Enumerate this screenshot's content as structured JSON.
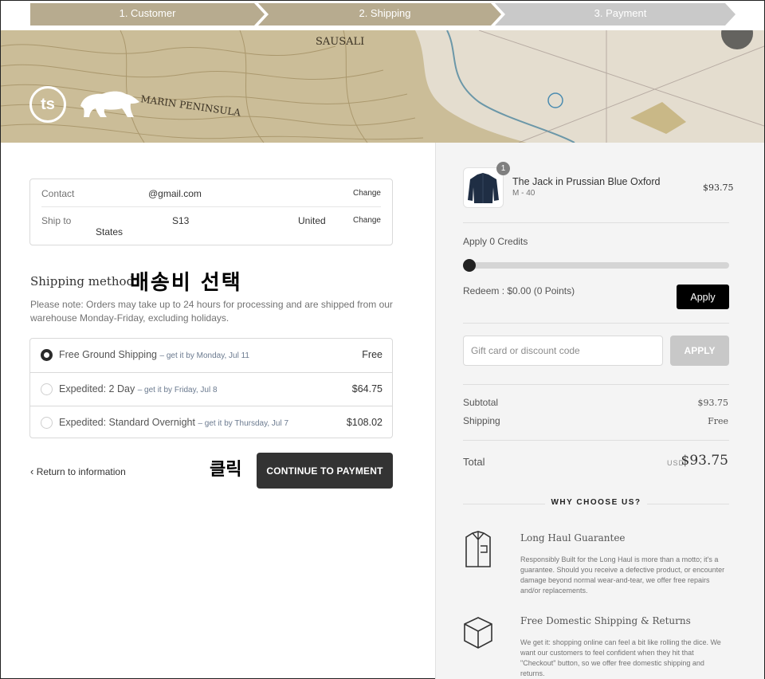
{
  "steps": [
    {
      "label": "1. Customer",
      "state": "done"
    },
    {
      "label": "2. Shipping",
      "state": "active"
    },
    {
      "label": "3. Payment",
      "state": "todo"
    }
  ],
  "colors": {
    "step_done": "#b7ab8f",
    "step_todo": "#c9c9c9",
    "button_dark": "#333333",
    "apply_black": "#000000"
  },
  "banner": {
    "map_texts": [
      "SAUSALI",
      "MARIN PENINSULA"
    ],
    "logo_text": "ts"
  },
  "contact": {
    "contact_label": "Contact",
    "contact_value": "@gmail.com",
    "ship_label": "Ship to",
    "ship_value_a": "S13",
    "ship_value_b": "United",
    "ship_value_c": "States",
    "change_label": "Change"
  },
  "shipping": {
    "title": "Shipping method",
    "annotation": "배송비 선택",
    "note": "Please note: Orders may take up to 24 hours for processing and are shipped from our warehouse Monday-Friday, excluding holidays.",
    "methods": [
      {
        "name": "Free Ground Shipping",
        "eta": "get it by Monday, Jul 11",
        "price": "Free",
        "selected": true
      },
      {
        "name": "Expedited: 2 Day",
        "eta": "get it by Friday, Jul 8",
        "price": "$64.75",
        "selected": false
      },
      {
        "name": "Expedited: Standard Overnight",
        "eta": "get it by Thursday, Jul 7",
        "price": "$108.02",
        "selected": false
      }
    ],
    "separator": "–"
  },
  "footer_actions": {
    "return_label": "Return to information",
    "click_annotation": "클릭",
    "continue_label": "CONTINUE TO PAYMENT"
  },
  "sidebar": {
    "product": {
      "name": "The Jack in Prussian Blue Oxford",
      "variant": "M - 40",
      "price": "$93.75",
      "quantity": "1"
    },
    "credits_label": "Apply 0 Credits",
    "credits_value": 0,
    "redeem_label": "Redeem : $0.00 (0 Points)",
    "apply_label": "Apply",
    "gift_placeholder": "Gift card or discount code",
    "gift_apply_label": "APPLY",
    "subtotal_label": "Subtotal",
    "subtotal_value": "$93.75",
    "shipping_label": "Shipping",
    "shipping_value": "Free",
    "total_label": "Total",
    "total_currency": "USD",
    "total_value": "$93.75",
    "why_title": "WHY CHOOSE US?",
    "features": [
      {
        "title": "Long Haul Guarantee",
        "text": "Responsibly Built for the Long Haul is more than a motto; it's a guarantee. Should you receive a defective product, or encounter damage beyond normal wear-and-tear, we offer free repairs and/or replacements."
      },
      {
        "title": "Free Domestic Shipping & Returns",
        "text": "We get it: shopping online can feel a bit like rolling the dice. We want our customers to feel confident when they hit that \"Checkout\" button, so we offer free domestic shipping and returns."
      }
    ]
  }
}
